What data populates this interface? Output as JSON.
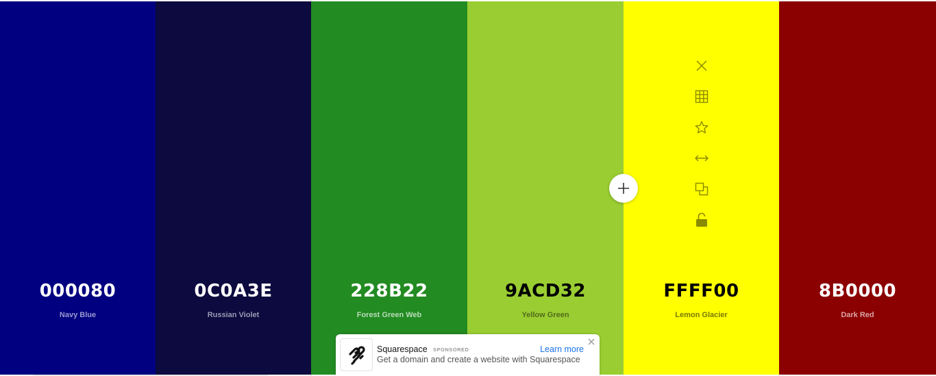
{
  "palette": {
    "colors": [
      {
        "hex": "000080",
        "name": "Navy Blue",
        "bg": "#000080",
        "hex_color": "#ffffff",
        "name_color": "#9a9ad0"
      },
      {
        "hex": "0C0A3E",
        "name": "Russian Violet",
        "bg": "#0C0A3E",
        "hex_color": "#ffffff",
        "name_color": "#9a99b3"
      },
      {
        "hex": "228B22",
        "name": "Forest Green Web",
        "bg": "#228B22",
        "hex_color": "#ffffff",
        "name_color": "#b8dcb8"
      },
      {
        "hex": "9ACD32",
        "name": "Yellow Green",
        "bg": "#9ACD32",
        "hex_color": "#000000",
        "name_color": "#4f6b1a"
      },
      {
        "hex": "FFFF00",
        "name": "Lemon Glacier",
        "bg": "#FFFF00",
        "hex_color": "#000000",
        "name_color": "#7a7a00"
      },
      {
        "hex": "8B0000",
        "name": "Dark Red",
        "bg": "#8B0000",
        "hex_color": "#ffffff",
        "name_color": "#dba6a6"
      }
    ],
    "active_index": 4,
    "tool_icon_color": "#8a8a00",
    "tools": [
      "close-icon",
      "grid-icon",
      "star-icon",
      "drag-arrows-icon",
      "copy-icon",
      "unlock-icon"
    ]
  },
  "add_button_icon": "plus-icon",
  "ad": {
    "brand": "Squarespace",
    "tag": "SPONSORED",
    "link": "Learn more",
    "description": "Get a domain and create a website with Squarespace"
  }
}
